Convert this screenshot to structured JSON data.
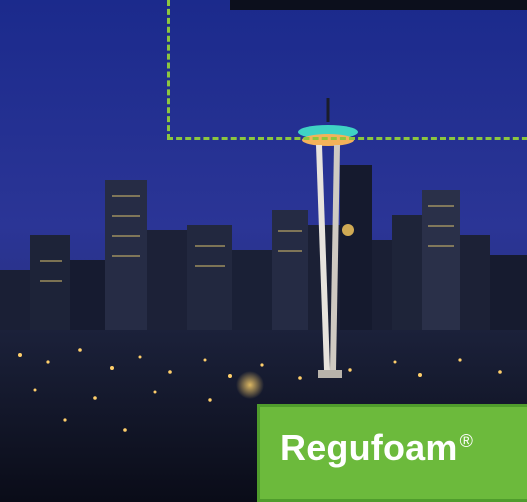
{
  "brand": {
    "name": "Regufoam",
    "registered_mark": "®"
  },
  "colors": {
    "sky_top": "#1a2a8a",
    "sky_bottom": "#2f3c9a",
    "accent_green": "#6cba3c",
    "dashed_border": "#8cc63f",
    "city_dark": "#1b213a",
    "tower_glow": "#3fd3c4"
  }
}
